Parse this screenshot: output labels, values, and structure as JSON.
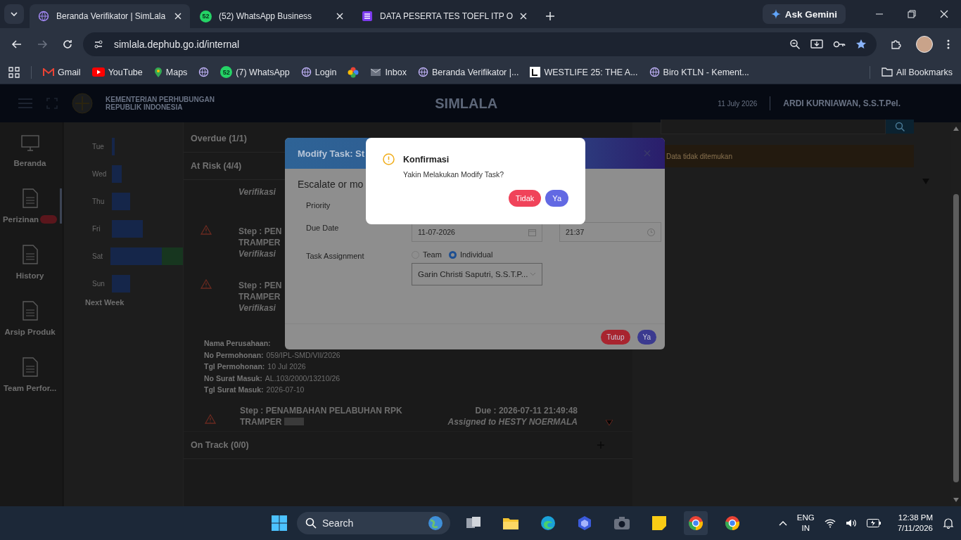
{
  "browser": {
    "tabs": [
      {
        "title": "Beranda Verifikator | SimLala",
        "selected": true,
        "kind": "globe"
      },
      {
        "title": "(52) WhatsApp Business",
        "selected": false,
        "kind": "chat",
        "badge": "52"
      },
      {
        "title": "DATA PESERTA TES TOEFL ITP O",
        "selected": false,
        "kind": "sheet"
      }
    ],
    "ask_gemini": "Ask Gemini",
    "url": "simlala.dephub.go.id/internal",
    "bookmarks": [
      {
        "label": "Gmail",
        "kind": "mail"
      },
      {
        "label": "YouTube",
        "kind": "play"
      },
      {
        "label": "Maps",
        "kind": "pin"
      },
      {
        "kind": "globe"
      },
      {
        "label": "(7) WhatsApp",
        "kind": "chat",
        "badge": "52"
      },
      {
        "label": "Login",
        "kind": "globe"
      },
      {
        "kind": "pinwheel"
      },
      {
        "label": "Inbox",
        "kind": "envelope"
      },
      {
        "label": "Beranda Verifikator |...",
        "kind": "globe"
      },
      {
        "label": "WESTLIFE 25: THE A...",
        "kind": "square"
      },
      {
        "label": "Biro KTLN - Kement...",
        "kind": "globe"
      }
    ],
    "all_bookmarks": "All Bookmarks"
  },
  "header": {
    "org_line_1": "KEMENTERIAN PERHUBUNGAN",
    "org_line_2": "REPUBLIK INDONESIA",
    "app_title": "SIMLALA",
    "date": "11 July 2026",
    "user": "ARDI KURNIAWAN, S.S.T.Pel."
  },
  "sidebar": {
    "items": [
      {
        "label": "Beranda",
        "kind": "monitor",
        "selected": false,
        "badge": false
      },
      {
        "label": "Perizinan",
        "kind": "document",
        "selected": true,
        "badge": true
      },
      {
        "label": "History",
        "kind": "document",
        "selected": false,
        "badge": false
      },
      {
        "label": "Arsip Produk",
        "kind": "document",
        "selected": false,
        "badge": false
      },
      {
        "label": "Team Perfor...",
        "kind": "document",
        "selected": false,
        "badge": false
      }
    ]
  },
  "week_chart": {
    "days": [
      "Tue",
      "Wed",
      "Thu",
      "Fri",
      "Sat",
      "Sun"
    ],
    "footer": "Next Week"
  },
  "task_panel": {
    "overdue": "Overdue (1/1)",
    "at_risk": "At Risk (4/4)",
    "items": [
      {
        "verification": "Verifikasi"
      },
      {
        "step": "Step : PEN",
        "step_2": "TRAMPER",
        "verification": "Verifikasi"
      },
      {
        "step": "Step : PEN",
        "step_2": "TRAMPER",
        "verification": "Verifikasi"
      }
    ],
    "details": [
      {
        "label": "Nama Perusahaan:"
      },
      {
        "label": "No Permohonan:",
        "value": "059/IPL-SMD/VII/2026"
      },
      {
        "label": "Tgl Permohonan:",
        "value": "10 Jul 2026"
      },
      {
        "label": "No Surat Masuk:",
        "value": "AL.103/2000/13210/26"
      },
      {
        "label": "Tgl Surat Masuk:",
        "value": "2026-07-10"
      }
    ],
    "last_step": {
      "step": "Step : PENAMBAHAN PELABUHAN RPK",
      "step_2": "TRAMPER",
      "due": "Due : 2026-07-11 21:49:48",
      "assigned": "Assigned to HESTY NOERMALA"
    },
    "on_track": "On Track (0/0)"
  },
  "right_panel": {
    "alert": "Data tidak ditemukan"
  },
  "modal": {
    "title": "Modify Task: St",
    "subtitle": "Escalate or mo",
    "priority_label": "Priority",
    "due_label": "Due Date",
    "due_date": "11-07-2026",
    "due_time": "21:37",
    "assignment_label": "Task Assignment",
    "options": [
      {
        "label": "Team",
        "selected": false
      },
      {
        "label": "Individual",
        "selected": true
      }
    ],
    "assignee": "Garin Christi Saputri, S.S.T.P...",
    "close_label": "Tutup",
    "ok_label": "Ya"
  },
  "confirm": {
    "title": "Konfirmasi",
    "message": "Yakin Melakukan Modify Task?",
    "cancel": "Tidak",
    "ok": "Ya"
  },
  "taskbar": {
    "search": "Search",
    "lang_1": "ENG",
    "lang_2": "IN",
    "time": "12:38 PM",
    "date": "7/11/2026"
  }
}
